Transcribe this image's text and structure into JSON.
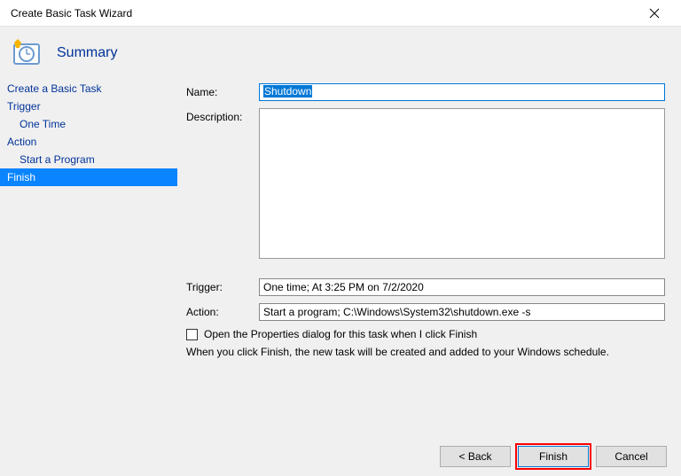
{
  "window": {
    "title": "Create Basic Task Wizard"
  },
  "banner": {
    "heading": "Summary"
  },
  "sidebar": {
    "items": [
      {
        "label": "Create a Basic Task",
        "indent": false,
        "active": false
      },
      {
        "label": "Trigger",
        "indent": false,
        "active": false
      },
      {
        "label": "One Time",
        "indent": true,
        "active": false
      },
      {
        "label": "Action",
        "indent": false,
        "active": false
      },
      {
        "label": "Start a Program",
        "indent": true,
        "active": false
      },
      {
        "label": "Finish",
        "indent": false,
        "active": true
      }
    ]
  },
  "form": {
    "name_label": "Name:",
    "name_value": "Shutdown",
    "description_label": "Description:",
    "description_value": "",
    "trigger_label": "Trigger:",
    "trigger_value": "One time; At 3:25 PM on 7/2/2020",
    "action_label": "Action:",
    "action_value": "Start a program; C:\\Windows\\System32\\shutdown.exe -s",
    "checkbox_label": "Open the Properties dialog for this task when I click Finish",
    "checkbox_checked": false,
    "info": "When you click Finish, the new task will be created and added to your Windows schedule."
  },
  "buttons": {
    "back": "< Back",
    "finish": "Finish",
    "cancel": "Cancel"
  }
}
